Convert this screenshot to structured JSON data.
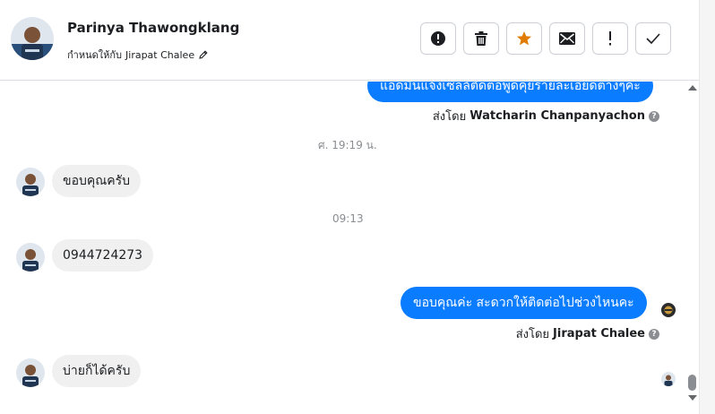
{
  "contact": {
    "name": "Parinya Thawongklang",
    "assign_label": "กำหนดให้กับ",
    "assignee": "Jirapat Chalee"
  },
  "actions": [
    {
      "name": "spam-button",
      "icon": "exclamation-circle-icon"
    },
    {
      "name": "delete-button",
      "icon": "trash-icon"
    },
    {
      "name": "star-button",
      "icon": "star-icon",
      "color": "#e07b00"
    },
    {
      "name": "mark-unread-button",
      "icon": "envelope-icon"
    },
    {
      "name": "follow-up-button",
      "icon": "exclamation-icon"
    },
    {
      "name": "done-button",
      "icon": "check-icon"
    }
  ],
  "messages": {
    "m1_text": "แอดมินแจ้งเซลล์ติดต่อพูดคุยรายละเอียดต่างๆค่ะ",
    "m1_sent_by_label": "ส่งโดย",
    "m1_sender": "Watcharin Chanpanyachon",
    "ts1": "ศ. 19:19 น.",
    "m2_text": "ขอบคุณครับ",
    "ts2": "09:13",
    "m3_text": "0944724273",
    "m4_text": "ขอบคุณค่ะ สะดวกให้ติดต่อไปช่วงไหนคะ",
    "m4_sent_by_label": "ส่งโดย",
    "m4_sender": "Jirapat Chalee",
    "m5_text": "บ่ายก็ได้ครับ"
  },
  "colors": {
    "outgoing_bubble": "#0a7cff",
    "incoming_bubble": "#f0f0f0",
    "star": "#e07b00"
  }
}
